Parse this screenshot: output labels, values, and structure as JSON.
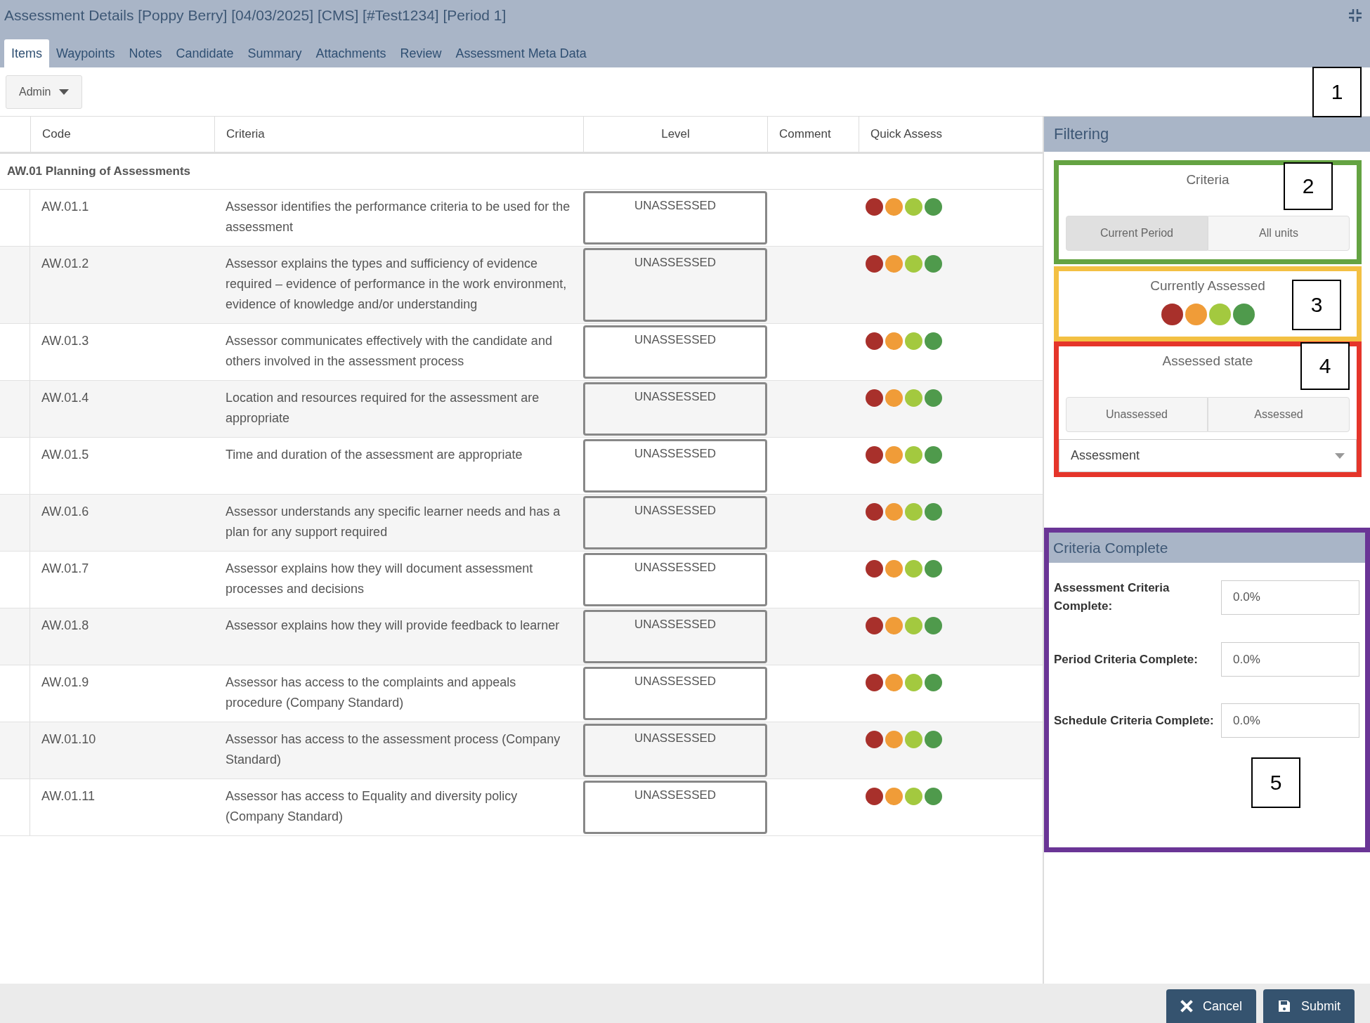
{
  "window": {
    "title": "Assessment Details [Poppy Berry] [04/03/2025] [CMS] [#Test1234] [Period 1]"
  },
  "tabs": [
    {
      "label": "Items",
      "selected": true
    },
    {
      "label": "Waypoints",
      "selected": false
    },
    {
      "label": "Notes",
      "selected": false
    },
    {
      "label": "Candidate",
      "selected": false
    },
    {
      "label": "Summary",
      "selected": false
    },
    {
      "label": "Attachments",
      "selected": false
    },
    {
      "label": "Review",
      "selected": false
    },
    {
      "label": "Assessment Meta Data",
      "selected": false
    }
  ],
  "toolbar": {
    "dropdown": "Admin",
    "callout": "1"
  },
  "table": {
    "columns": [
      "Code",
      "Criteria",
      "Level",
      "Comment",
      "Quick Assess"
    ],
    "quick_assess": [
      {
        "color": "#a8302b"
      },
      {
        "color": "#f09c38"
      },
      {
        "color": "#a3c93f"
      },
      {
        "color": "#4f9a4c"
      }
    ],
    "group": "AW.01 Planning of Assessments",
    "rows": [
      {
        "code": "AW.01.1",
        "criteria": "Assessor identifies the performance criteria to be used for the assessment",
        "level": "UNASSESSED"
      },
      {
        "code": "AW.01.2",
        "criteria": "Assessor explains the types and sufficiency of evidence required – evidence of performance in the work environment, evidence of knowledge and/or understanding",
        "level": "UNASSESSED"
      },
      {
        "code": "AW.01.3",
        "criteria": "Assessor communicates effectively with the candidate and others involved in the assessment process",
        "level": "UNASSESSED"
      },
      {
        "code": "AW.01.4",
        "criteria": "Location and resources required for the assessment are appropriate",
        "level": "UNASSESSED"
      },
      {
        "code": "AW.01.5",
        "criteria": "Time and duration of the assessment are appropriate",
        "level": "UNASSESSED"
      },
      {
        "code": "AW.01.6",
        "criteria": "Assessor understands any specific learner needs and has a plan for any support required",
        "level": "UNASSESSED"
      },
      {
        "code": "AW.01.7",
        "criteria": "Assessor explains how they will document assessment processes and decisions",
        "level": "UNASSESSED"
      },
      {
        "code": "AW.01.8",
        "criteria": "Assessor explains how they will provide feedback to learner",
        "level": "UNASSESSED"
      },
      {
        "code": "AW.01.9",
        "criteria": "Assessor has access to the complaints and appeals procedure (Company Standard)",
        "level": "UNASSESSED"
      },
      {
        "code": "AW.01.10",
        "criteria": "Assessor has access to the assessment process (Company Standard)",
        "level": "UNASSESSED"
      },
      {
        "code": "AW.01.11",
        "criteria": "Assessor has access to Equality and diversity policy (Company Standard)",
        "level": "UNASSESSED"
      }
    ]
  },
  "filtering": {
    "title": "Filtering",
    "criteria": {
      "label": "Criteria",
      "callout": "2",
      "options": [
        {
          "label": "Current Period",
          "selected": true
        },
        {
          "label": "All units",
          "selected": false
        }
      ]
    },
    "currently_assessed": {
      "label": "Currently Assessed",
      "callout": "3",
      "dots": [
        {
          "color": "#a8302b"
        },
        {
          "color": "#f09c38"
        },
        {
          "color": "#a3c93f"
        },
        {
          "color": "#4f9a4c"
        }
      ]
    },
    "assessed_state": {
      "label": "Assessed state",
      "callout": "4",
      "options": [
        {
          "label": "Unassessed",
          "selected": false
        },
        {
          "label": "Assessed",
          "selected": false
        }
      ],
      "select": "Assessment"
    }
  },
  "criteria_complete": {
    "title": "Criteria Complete",
    "callout": "5",
    "fields": [
      {
        "label": "Assessment Criteria Complete:",
        "value": "0.0%"
      },
      {
        "label": "Period Criteria Complete:",
        "value": "0.0%"
      },
      {
        "label": "Schedule Criteria Complete:",
        "value": "0.0%"
      }
    ]
  },
  "footer": {
    "buttons": [
      {
        "kind": "cancel",
        "label": "Cancel"
      },
      {
        "kind": "submit",
        "label": "Submit"
      }
    ]
  }
}
